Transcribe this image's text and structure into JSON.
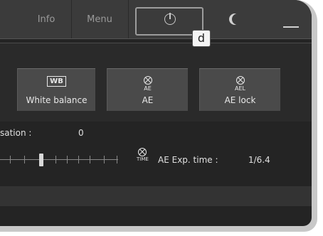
{
  "topbar": {
    "tabs": [
      {
        "label": "Info"
      },
      {
        "label": "Menu"
      }
    ],
    "power_icon": "power-icon",
    "moon_icon": "moon-icon",
    "minimize_icon": "minimize-icon"
  },
  "callout": {
    "label": "d"
  },
  "buttons": {
    "white_balance": {
      "icon_text": "WB",
      "label": "White balance"
    },
    "ae": {
      "icon_sub": "AE",
      "label": "AE"
    },
    "ae_lock": {
      "icon_sub": "AEL",
      "label": "AE lock"
    }
  },
  "compensation": {
    "label": "sation :",
    "value": "0"
  },
  "exposure": {
    "icon_sub": "TIME",
    "label": "AE Exp. time :",
    "value": "1/6.4"
  },
  "colors": {
    "background": "#242424",
    "button": "#4a4a4a",
    "topbar": "#3b3b3b"
  }
}
